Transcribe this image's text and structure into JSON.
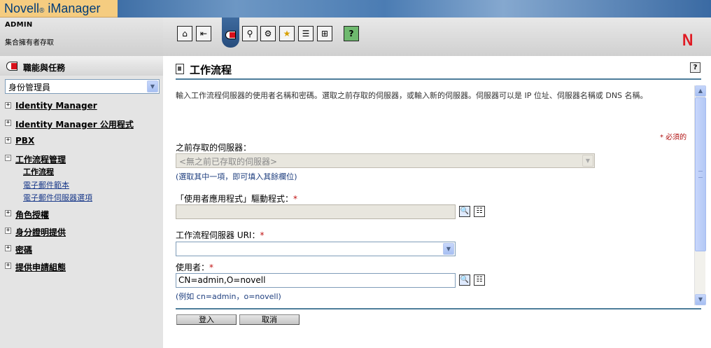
{
  "app": {
    "brand": "Novell",
    "brand_reg": "®",
    "product": " iManager",
    "user": "ADMIN",
    "role": "集合擁有者存取",
    "corner_logo": "N"
  },
  "toolbar": {
    "icons": [
      {
        "name": "home-icon",
        "glyph": "⌂"
      },
      {
        "name": "exit-icon",
        "glyph": "⇤"
      },
      {
        "name": "roles-tasks-icon",
        "glyph": ""
      },
      {
        "name": "view-objects-icon",
        "glyph": "⚲"
      },
      {
        "name": "configure-icon",
        "glyph": "⚙"
      },
      {
        "name": "favorites-icon",
        "glyph": "★"
      },
      {
        "name": "task-list-icon",
        "glyph": "☰"
      },
      {
        "name": "hierarchy-icon",
        "glyph": "⊞"
      },
      {
        "name": "help-book-icon",
        "glyph": "?"
      }
    ]
  },
  "sidebar": {
    "header": "職能與任務",
    "role_select": "身份管理員",
    "items": [
      {
        "label": "Identity Manager",
        "expanded": false
      },
      {
        "label": "Identity Manager 公用程式",
        "expanded": false
      },
      {
        "label": "PBX",
        "expanded": false
      },
      {
        "label": "工作流程管理",
        "expanded": true
      },
      {
        "label": "角色授權",
        "expanded": false
      },
      {
        "label": "身分證明提供",
        "expanded": false
      },
      {
        "label": "密碼",
        "expanded": false
      },
      {
        "label": "提供申請組態",
        "expanded": false
      }
    ],
    "subitems": [
      {
        "label": "工作流程",
        "active": true
      },
      {
        "label": "電子郵件範本",
        "active": false
      },
      {
        "label": "電子郵件伺服器選項",
        "active": false
      }
    ],
    "expand_glyph": "+",
    "collapse_glyph": "−"
  },
  "main": {
    "title": "工作流程",
    "help": "?",
    "description": "輸入工作流程伺服器的使用者名稱和密碼。選取之前存取的伺服器，或輸入新的伺服器。伺服器可以是 IP 位址、伺服器名稱或 DNS 名稱。",
    "required_note": "* 必須的",
    "prev_server_label": "之前存取的伺服器：",
    "prev_server_value": "<無之前已存取的伺服器>",
    "prev_server_hint": "(選取其中一項，即可填入其餘欄位)",
    "driver_label": "「使用者應用程式」驅動程式：",
    "driver_value": "",
    "uri_label": "工作流程伺服器 URI：",
    "uri_value": "",
    "user_label": "使用者：",
    "user_value": "CN=admin,O=novell",
    "user_hint": "(例如 cn=admin，o=novell)",
    "star": "*",
    "search_glyph": "🔍",
    "browse_glyph": "☷",
    "dropdown_glyph": "▼"
  },
  "buttons": {
    "login": "登入",
    "cancel": "取消"
  },
  "scrollbar": {
    "up": "▲",
    "down": "▼"
  }
}
